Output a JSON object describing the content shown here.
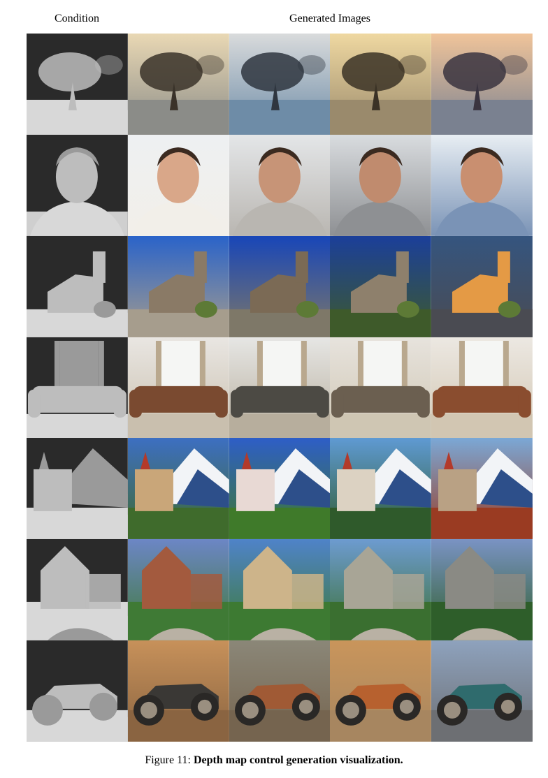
{
  "header": {
    "condition_label": "Condition",
    "generated_label": "Generated Images"
  },
  "caption": {
    "prefix": "Figure 11: ",
    "text": "Depth map control generation visualization."
  },
  "rows": [
    {
      "subject": "tree-lake",
      "palettes": [
        {
          "sky": "#e9d8b4",
          "ground": "#8b8c88",
          "accent": "#3a3229"
        },
        {
          "sky": "#d9dbdc",
          "ground": "#6e8ca7",
          "accent": "#2f3640"
        },
        {
          "sky": "#efd8a1",
          "ground": "#9a8a6c",
          "accent": "#3b3226"
        },
        {
          "sky": "#f0c49a",
          "ground": "#7a8190",
          "accent": "#3a3440"
        }
      ]
    },
    {
      "subject": "portrait",
      "palettes": [
        {
          "sky": "#eef0f2",
          "ground": "#f2efe9",
          "accent": "#d9a789"
        },
        {
          "sky": "#e4e6e8",
          "ground": "#b9b6b1",
          "accent": "#c79477"
        },
        {
          "sky": "#d9dcdf",
          "ground": "#8e9093",
          "accent": "#c08b6e"
        },
        {
          "sky": "#e8eef3",
          "ground": "#7a93b6",
          "accent": "#c98f70"
        }
      ]
    },
    {
      "subject": "chapel",
      "palettes": [
        {
          "sky": "#2a63c9",
          "ground": "#a69d8d",
          "accent": "#8a7a66"
        },
        {
          "sky": "#1846b8",
          "ground": "#7e7868",
          "accent": "#7b6a55"
        },
        {
          "sky": "#1b3f9a",
          "ground": "#3e5a2a",
          "accent": "#8e806c"
        },
        {
          "sky": "#35557f",
          "ground": "#4a4b52",
          "accent": "#e49a45"
        }
      ]
    },
    {
      "subject": "sofa",
      "palettes": [
        {
          "sky": "#e9e6e2",
          "ground": "#c9bfae",
          "accent": "#7a4a30"
        },
        {
          "sky": "#e6e6e4",
          "ground": "#b7ae9d",
          "accent": "#4c4a44"
        },
        {
          "sky": "#e7e3dd",
          "ground": "#cfc6b3",
          "accent": "#6b5f50"
        },
        {
          "sky": "#ece8e2",
          "ground": "#d2c6b2",
          "accent": "#8a4d2f"
        }
      ]
    },
    {
      "subject": "castle",
      "palettes": [
        {
          "sky": "#3d6fc2",
          "ground": "#3f6b2c",
          "accent": "#c9a679"
        },
        {
          "sky": "#2e5ec7",
          "ground": "#3f7a2a",
          "accent": "#e8d9d4"
        },
        {
          "sky": "#5f9ad3",
          "ground": "#2f5a2b",
          "accent": "#dcd2c2"
        },
        {
          "sky": "#7ba8d6",
          "ground": "#9a3b22",
          "accent": "#b9a184"
        }
      ]
    },
    {
      "subject": "mansion",
      "palettes": [
        {
          "sky": "#6c86c6",
          "ground": "#3f7a35",
          "accent": "#a35a3e"
        },
        {
          "sky": "#4f83c9",
          "ground": "#3d7a32",
          "accent": "#cdb48a"
        },
        {
          "sky": "#6d9bd0",
          "ground": "#3a6f30",
          "accent": "#a8a596"
        },
        {
          "sky": "#7a93c4",
          "ground": "#2e5e2a",
          "accent": "#8a8a84"
        }
      ]
    },
    {
      "subject": "vintage-car",
      "palettes": [
        {
          "sky": "#c7915a",
          "ground": "#8a6441",
          "accent": "#3a3835"
        },
        {
          "sky": "#8b8778",
          "ground": "#75644f",
          "accent": "#a05a35"
        },
        {
          "sky": "#c9955b",
          "ground": "#a78660",
          "accent": "#b7612f"
        },
        {
          "sky": "#8ea2bd",
          "ground": "#6d6f73",
          "accent": "#2f6b6d"
        }
      ]
    }
  ]
}
